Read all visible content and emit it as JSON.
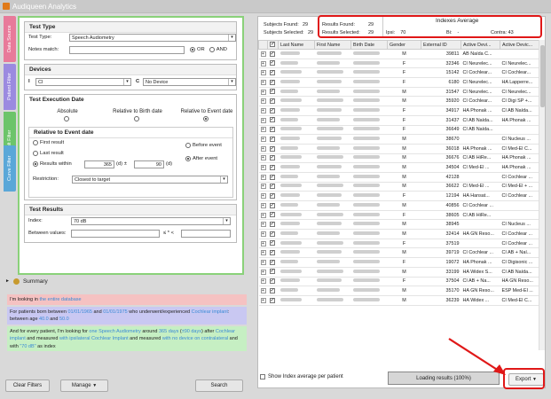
{
  "window": {
    "title": "Audiqueen Analytics"
  },
  "sidetabs": [
    {
      "label": "Data Source",
      "color": "#e87a9a"
    },
    {
      "label": "Patient Filter",
      "color": "#9b8ae0"
    },
    {
      "label": "Result Filter",
      "color": "#6cc46a"
    },
    {
      "label": "Curve Filter",
      "color": "#5aa7d8"
    }
  ],
  "test_type": {
    "title": "Test Type",
    "type_label": "Test Type:",
    "type_value": "Speech Audiometry",
    "notes_label": "Notes match:",
    "notes_value": "",
    "or_label": "OR",
    "and_label": "AND"
  },
  "devices": {
    "title": "Devices",
    "i_label": "I",
    "i_value": "CI",
    "c_label": "C",
    "c_value": "No Device"
  },
  "test_execution": {
    "title": "Test Execution Date",
    "absolute_label": "Absolute",
    "birth_label": "Relative to Birth date",
    "event_label": "Relative to Event date"
  },
  "relative_event": {
    "title": "Relative to Event date",
    "first_label": "First result",
    "last_label": "Last result",
    "within_label": "Results within",
    "days_value": "365",
    "d_unit": "(d)",
    "plusminus": "±",
    "tolerance_value": "90",
    "before_label": "Before event",
    "after_label": "After event",
    "restriction_label": "Restriction:",
    "restriction_value": "Closest to target"
  },
  "test_results": {
    "title": "Test Results",
    "index_label": "Index:",
    "index_value": "70 dB",
    "between_label": "Between values:",
    "between_min": "",
    "between_sep": "≤ * <",
    "between_max": ""
  },
  "summary": {
    "title": "Summary",
    "line1_prefix": "I'm looking in ",
    "line1_hl": "the entire database",
    "line2_a": "For patients born between ",
    "line2_b": "01/01/1965",
    "line2_c": " and ",
    "line2_d": "01/01/1975",
    "line2_e": " who underwent/experienced ",
    "line2_f": "Cochlear implant",
    "line2_g": ": between age ",
    "line2_h": "40.0",
    "line2_i": " and ",
    "line2_j": "50.0",
    "line3_a": "And for every patient, I'm looking for ",
    "line3_b": "one Speech Audiometry",
    "line3_c": " around ",
    "line3_d": "365 days",
    "line3_e": " (",
    "line3_f": "±90 days",
    "line3_g": ") after ",
    "line3_h": "Cochlear implant",
    "line3_i": " and measured ",
    "line3_j": "with ipsilateral Cochlear Implant",
    "line3_k": " and measured ",
    "line3_l": "with no device on contralateral",
    "line3_m": " and with ",
    "line3_n": "\"70 dB\"",
    "line3_o": " as index"
  },
  "buttons": {
    "clear": "Clear Filters",
    "manage": "Manage",
    "search": "Search",
    "export": "Export"
  },
  "stats": {
    "subjects_found_label": "Subjects Found:",
    "subjects_found_value": "29",
    "subjects_selected_label": "Subjects Selected:",
    "subjects_selected_value": "29",
    "results_found_label": "Results Found:",
    "results_found_value": "29",
    "results_selected_label": "Results Selected:",
    "results_selected_value": "29",
    "indexes_title": "Indexes Average",
    "ipsi_label": "Ipsi:",
    "ipsi_value": "70",
    "bi_label": "Bi:",
    "bi_value": "-",
    "contra_label": "Contra:",
    "contra_value": "43"
  },
  "table": {
    "columns": [
      "Last Name",
      "First Name",
      "Birth Date",
      "Gender",
      "External ID",
      "Active Devi...",
      "Active Devic..."
    ],
    "rows": [
      [
        "M",
        "39811",
        "AB Naída C...",
        ""
      ],
      [
        "F",
        "32346",
        "CI Neurelec...",
        "CI Neurelec..."
      ],
      [
        "F",
        "15142",
        "CI Cochlear...",
        "CI Cochlear..."
      ],
      [
        "F",
        "6180",
        "CI Neurelec...",
        "HA Lapperre..."
      ],
      [
        "M",
        "31547",
        "CI Neurelec...",
        "CI Neurelec..."
      ],
      [
        "M",
        "35920",
        "CI Cochlear...",
        "CI Digi SP +..."
      ],
      [
        "F",
        "34917",
        "HA Phonak ...",
        "CI AB Naída..."
      ],
      [
        "F",
        "31437",
        "CI AB Naída...",
        "HA Phonak ..."
      ],
      [
        "F",
        "36649",
        "CI AB Naída...",
        ""
      ],
      [
        "M",
        "38670",
        "",
        "CI Nucleus ..."
      ],
      [
        "M",
        "36018",
        "HA Phonak ...",
        "CI Med-El C..."
      ],
      [
        "M",
        "36676",
        "CI AB HiRe...",
        "HA Phonak ..."
      ],
      [
        "M",
        "34504",
        "CI Med-El ...",
        "HA Phonak ..."
      ],
      [
        "M",
        "42128",
        "",
        "CI Cochlear ..."
      ],
      [
        "M",
        "36622",
        "CI Med-El ...",
        "CI Med-El + ..."
      ],
      [
        "F",
        "12194",
        "HA Hansat...",
        "CI Cochlear ..."
      ],
      [
        "M",
        "40856",
        "CI Cochlear ...",
        ""
      ],
      [
        "F",
        "38605",
        "CI AB HiRe...",
        ""
      ],
      [
        "M",
        "38945",
        "",
        "CI Nucleus ..."
      ],
      [
        "M",
        "32414",
        "HA GN Reso...",
        "CI Cochlear ..."
      ],
      [
        "F",
        "37519",
        "",
        "CI Cochlear ..."
      ],
      [
        "M",
        "39719",
        "CI Cochlear ...",
        "CI AB + Naí..."
      ],
      [
        "F",
        "19072",
        "HA Phonak ...",
        "CI Digisonic ..."
      ],
      [
        "M",
        "33199",
        "HA Widex S...",
        "CI AB Naída..."
      ],
      [
        "F",
        "37504",
        "CI AB + Na...",
        "HA GN Reso..."
      ],
      [
        "M",
        "35170",
        "HA GN Reso...",
        "ESP Med-El ..."
      ],
      [
        "M",
        "36239",
        "HA Widex ...",
        "CI Med-El C..."
      ]
    ]
  },
  "footer": {
    "show_avg_label": "Show Index average per patient",
    "loading_label": "Loading results (100%)"
  }
}
